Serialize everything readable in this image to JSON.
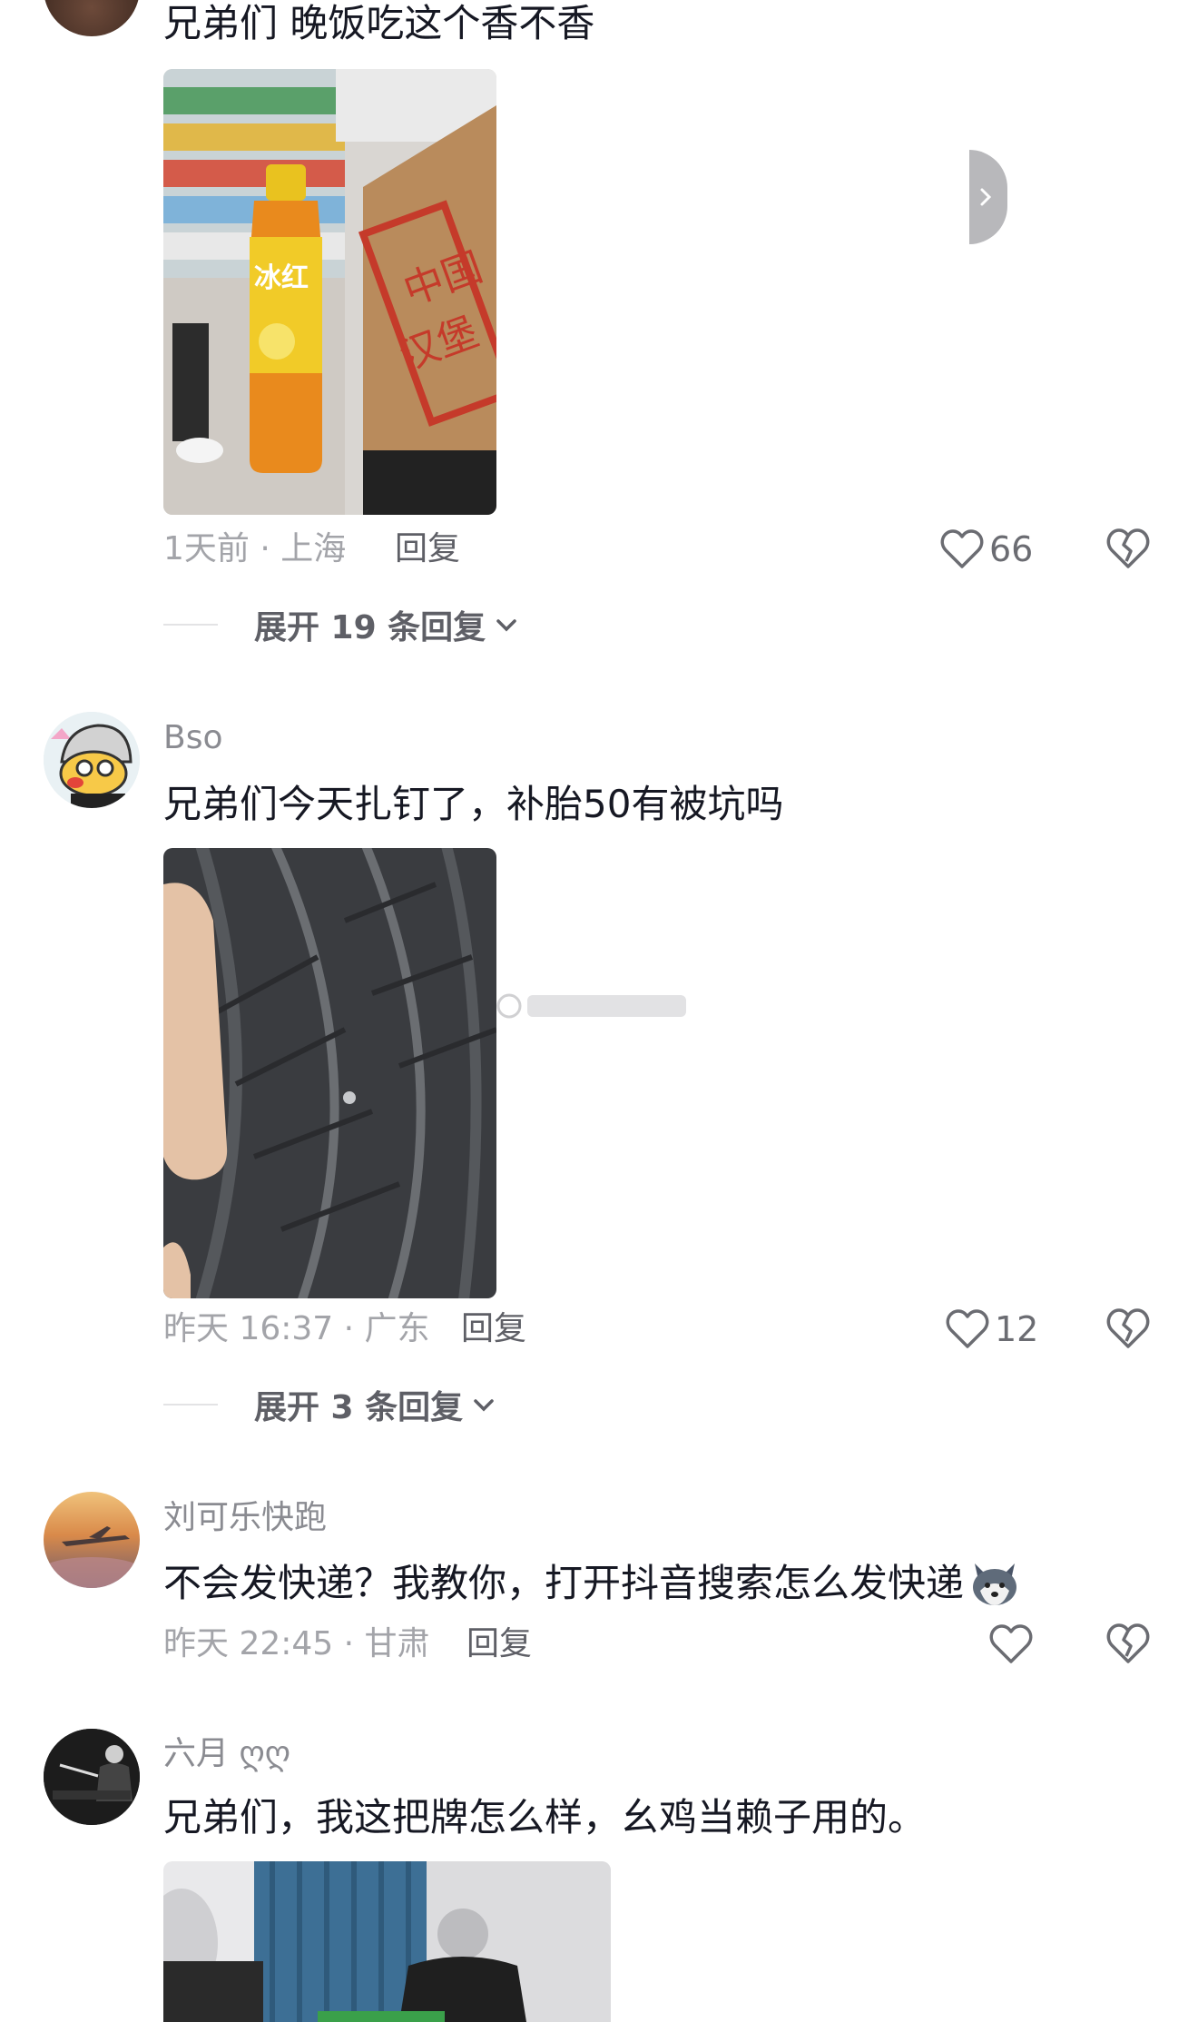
{
  "comments": [
    {
      "text": "兄弟们 晚饭吃这个香不香",
      "meta": "1天前 · 上海",
      "reply_label": "回复",
      "likes": "66",
      "expand_label": "展开 19 条回复",
      "photo_icon": "photo-drink-bottle"
    },
    {
      "username": "Bso",
      "text": "兄弟们今天扎钉了，补胎50有被坑吗",
      "meta": "昨天 16:37 · 广东",
      "reply_label": "回复",
      "likes": "12",
      "expand_label": "展开 3 条回复",
      "photo_icon": "photo-tire-nail"
    },
    {
      "username": "刘可乐快跑",
      "text": "不会发快递？我教你，打开抖音搜索怎么发快递",
      "meta": "昨天 22:45 · 甘肃",
      "reply_label": "回复",
      "likes": "",
      "emoji_icon": "husky-emoji-icon"
    },
    {
      "username": "六月 ღღ",
      "text": "兄弟们，我这把牌怎么样，幺鸡当赖子用的。",
      "photo_icon": "photo-mahjong-table"
    }
  ],
  "colors": {
    "text": "#161823",
    "secondary": "#a3a4a9",
    "username": "#8a8b91",
    "reply": "#5e5f66"
  }
}
